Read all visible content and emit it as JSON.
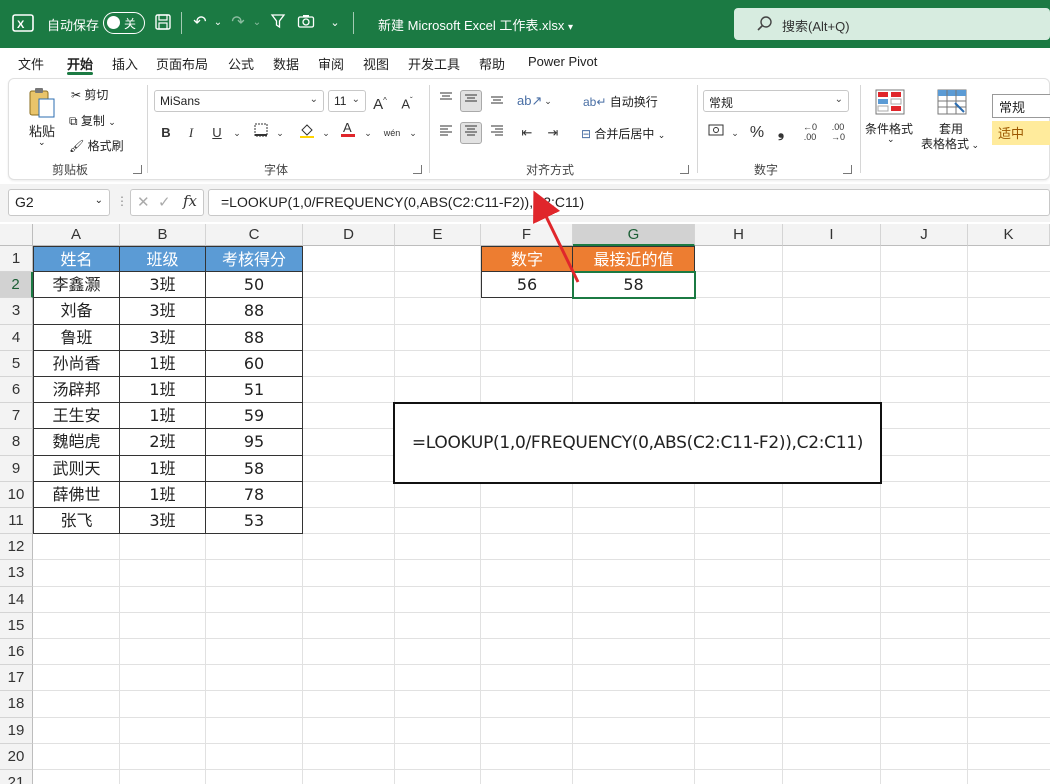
{
  "titlebar": {
    "autosave_label": "自动保存",
    "autosave_state": "关",
    "doc_title": "新建 Microsoft Excel 工作表.xlsx",
    "search_placeholder": "搜索(Alt+Q)"
  },
  "menu": [
    "文件",
    "开始",
    "插入",
    "页面布局",
    "公式",
    "数据",
    "审阅",
    "视图",
    "开发工具",
    "帮助",
    "Power Pivot"
  ],
  "ribbon": {
    "clipboard": {
      "paste": "粘贴",
      "cut": "剪切",
      "copy": "复制",
      "format_painter": "格式刷",
      "label": "剪贴板"
    },
    "font": {
      "name": "MiSans",
      "size": "11",
      "bold": "B",
      "italic": "I",
      "underline": "U",
      "label": "字体"
    },
    "alignment": {
      "wrap": "自动换行",
      "merge": "合并后居中",
      "label": "对齐方式"
    },
    "number": {
      "format": "常规",
      "label": "数字"
    },
    "styles": {
      "conditional": "条件格式",
      "table1": "套用",
      "table2": "表格格式",
      "normal": "常规",
      "neutral": "适中"
    }
  },
  "formula_bar": {
    "name_box": "G2",
    "formula": "=LOOKUP(1,0/FREQUENCY(0,ABS(C2:C11-F2)),C2:C11)"
  },
  "grid": {
    "columns": [
      "A",
      "B",
      "C",
      "D",
      "E",
      "F",
      "G",
      "H",
      "I",
      "J",
      "K"
    ],
    "rows": [
      "1",
      "2",
      "3",
      "4",
      "5",
      "6",
      "7",
      "8",
      "9",
      "10",
      "11",
      "12",
      "13",
      "14",
      "15",
      "16",
      "17",
      "18",
      "19",
      "20",
      "21"
    ],
    "table_headers": [
      "姓名",
      "班级",
      "考核得分"
    ],
    "table_rows": [
      [
        "李鑫灏",
        "3班",
        "50"
      ],
      [
        "刘备",
        "3班",
        "88"
      ],
      [
        "鲁班",
        "3班",
        "88"
      ],
      [
        "孙尚香",
        "1班",
        "60"
      ],
      [
        "汤辟邦",
        "1班",
        "51"
      ],
      [
        "王生安",
        "1班",
        "59"
      ],
      [
        "魏皑虎",
        "2班",
        "95"
      ],
      [
        "武则天",
        "1班",
        "58"
      ],
      [
        "薛佛世",
        "1班",
        "78"
      ],
      [
        "张飞",
        "3班",
        "53"
      ]
    ],
    "lookup_headers": [
      "数字",
      "最接近的值"
    ],
    "lookup_values": [
      "56",
      "58"
    ]
  },
  "formula_box_text": "=LOOKUP(1,0/FREQUENCY(0,ABS(C2:C11-F2)),C2:C11)",
  "colors": {
    "excel_green": "#1b7a43",
    "header_blue": "#5b9bd5",
    "header_orange": "#ed7d31",
    "arrow_red": "#e0262b"
  }
}
